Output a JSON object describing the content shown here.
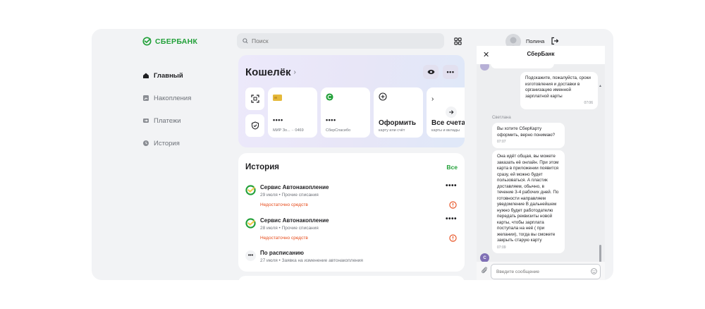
{
  "brand": {
    "name": "СБЕРБАНК",
    "color": "#21a038"
  },
  "sidebar": {
    "items": [
      {
        "label": "Главный",
        "icon": "home-icon",
        "active": true
      },
      {
        "label": "Накопления",
        "icon": "savings-icon",
        "active": false
      },
      {
        "label": "Платежи",
        "icon": "payments-icon",
        "active": false
      },
      {
        "label": "История",
        "icon": "history-icon",
        "active": false
      }
    ]
  },
  "search": {
    "placeholder": "Поиск"
  },
  "user": {
    "name": "Полина"
  },
  "wallet": {
    "title": "Кошелёк",
    "cards": [
      {
        "dots": "••••",
        "sub": "МИР Зо... ·· 0469"
      },
      {
        "dots": "••••",
        "sub": "СберСпасибо"
      }
    ],
    "issue": {
      "title": "Оформить",
      "sub": "карту или счёт"
    },
    "all_accounts": {
      "title": "Все счета",
      "sub": "карты и вклады"
    }
  },
  "history": {
    "title": "История",
    "all_label": "Все",
    "operations": [
      {
        "title": "Сервис Автонакопление",
        "sub": "29 июля • Прочие списания",
        "error": "Недостаточно средств"
      },
      {
        "title": "Сервис Автонакопление",
        "sub": "28 июля • Прочие списания",
        "error": "Недостаточно средств"
      },
      {
        "title": "По расписанию",
        "sub": "27 июля • Заявка на изменение автонакопления",
        "error": ""
      }
    ],
    "menu_label": "••••"
  },
  "chat": {
    "title": "СберБанк",
    "messages": [
      {
        "text": "Подскажите, пожалуйста, сроки изготовления и доставки в организацию именной зарплатной карты",
        "time": "07:06"
      },
      {
        "sender": "Светлана",
        "text": "Вы хотите СберКарту оформить, верно понимаю?",
        "time": "07:07"
      },
      {
        "text": "Она идёт общая, вы можете заказать её онлайн. При этом карта в приложении появится сразу, ей можно будет пользоваться. А пластик доставляем, обычно, в течение 3-4 рабочих дней. По готовности направляем уведомление В дальнейшем нужно будет работодателю передать реквизиты новой карты, чтобы зарплата поступала на неё ( при желании), тогда вы сможете закрыть старую карту",
        "time": "07:09"
      }
    ],
    "avatar_letter": "С",
    "input_placeholder": "Введите сообщение"
  }
}
